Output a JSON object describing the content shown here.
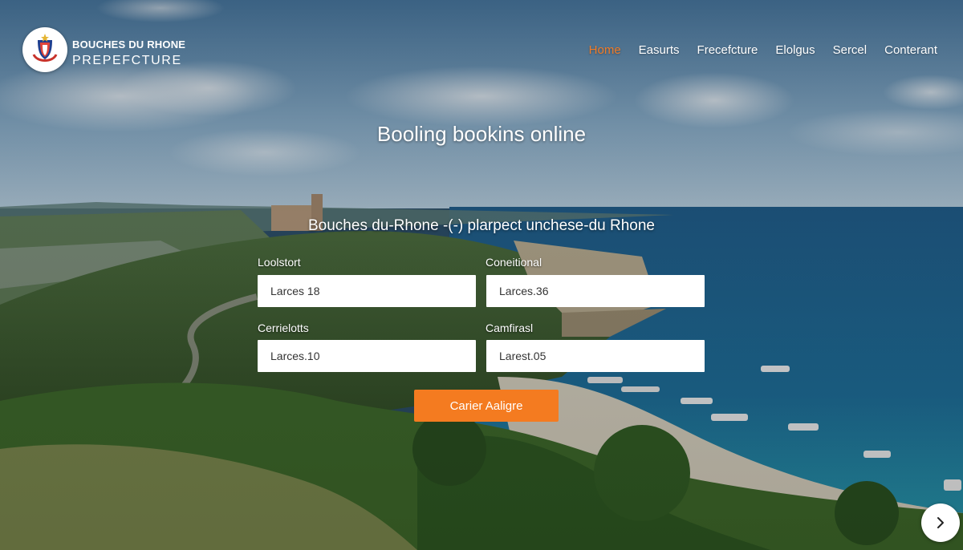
{
  "header": {
    "brand_line1": "BOUCHES DU RHONE",
    "brand_line2": "PREPEFCTURE",
    "logo_icon": "prefecture-emblem-icon"
  },
  "nav": {
    "items": [
      {
        "label": "Home",
        "active": true
      },
      {
        "label": "Easurts",
        "active": false
      },
      {
        "label": "Frecefcture",
        "active": false
      },
      {
        "label": "Elolgus",
        "active": false
      },
      {
        "label": "Sercel",
        "active": false
      },
      {
        "label": "Conterant",
        "active": false
      }
    ],
    "active_color": "#f07c28"
  },
  "hero": {
    "headline": "Booling bookins online",
    "subheadline": "Bouches du-Rhone -(-) plarpect unchese-du Rhone"
  },
  "form": {
    "fields": [
      {
        "label": "Loolstort",
        "value": "Larces 18"
      },
      {
        "label": "Coneitional",
        "value": "Larces.36"
      },
      {
        "label": "Cerrielotts",
        "value": "Larces.10"
      },
      {
        "label": "Camfirasl",
        "value": "Larest.05"
      }
    ],
    "submit_label": "Carier Aaligre",
    "accent_color": "#f47b20"
  },
  "carousel": {
    "next_icon": "chevron-right-icon"
  }
}
